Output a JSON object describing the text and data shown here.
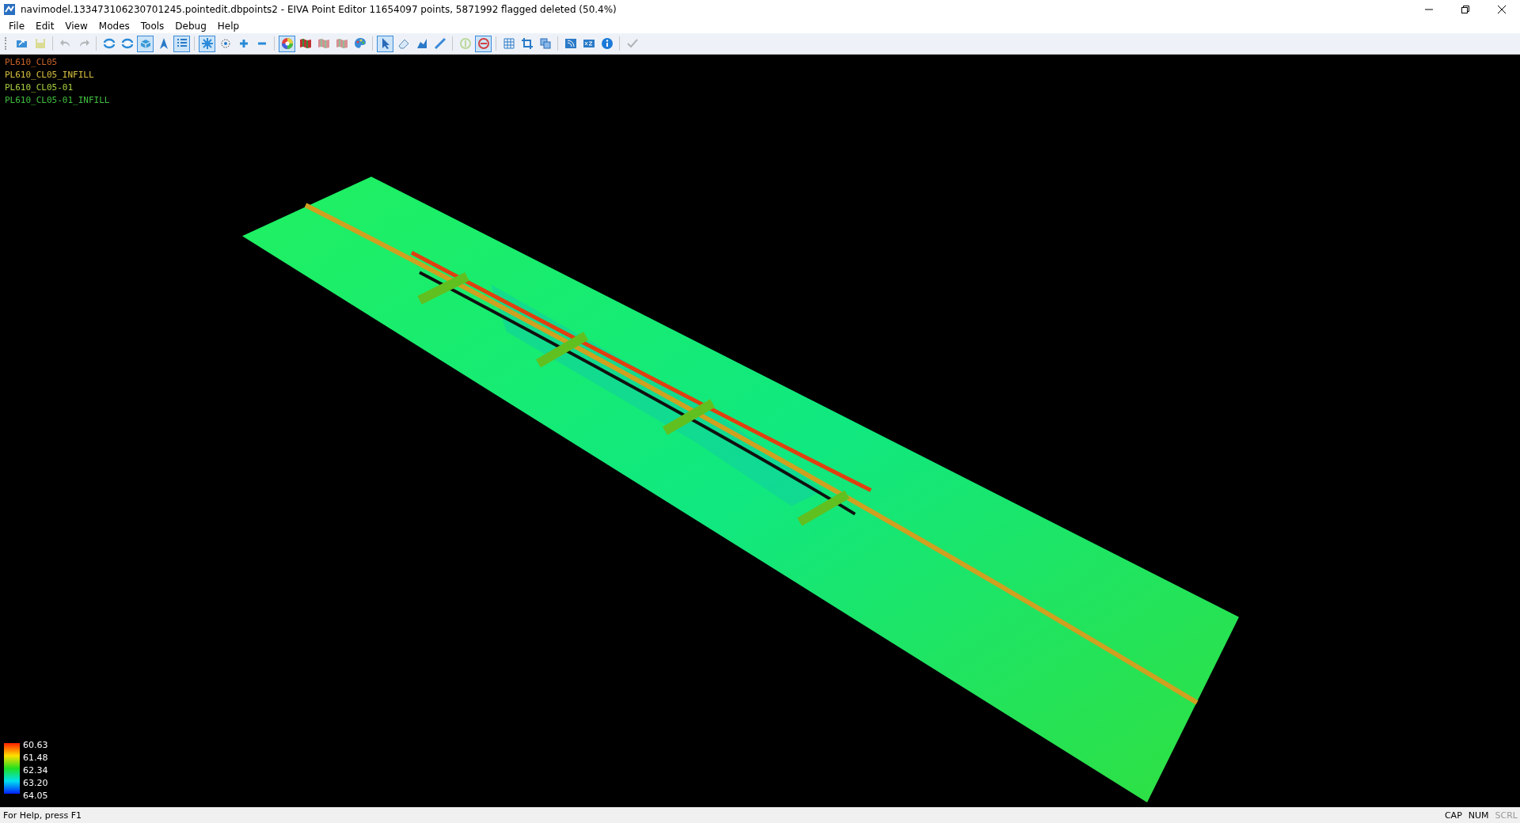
{
  "window": {
    "title": "navimodel.133473106230701245.pointedit.dbpoints2 - EIVA Point Editor 11654097 points, 5871992 flagged deleted (50.4%)"
  },
  "menu": [
    "File",
    "Edit",
    "View",
    "Modes",
    "Tools",
    "Debug",
    "Help"
  ],
  "toolbar": [
    {
      "kind": "open",
      "on": false,
      "disabled": false
    },
    {
      "kind": "save",
      "on": false,
      "disabled": true
    },
    {
      "kind": "separator"
    },
    {
      "kind": "undo",
      "on": false,
      "disabled": true
    },
    {
      "kind": "redo",
      "on": false,
      "disabled": true
    },
    {
      "kind": "separator"
    },
    {
      "kind": "rotate",
      "on": false,
      "disabled": false
    },
    {
      "kind": "rotate",
      "on": false,
      "disabled": false
    },
    {
      "kind": "cube",
      "on": true,
      "disabled": false
    },
    {
      "kind": "north",
      "on": false,
      "disabled": false
    },
    {
      "kind": "list",
      "on": true,
      "disabled": false
    },
    {
      "kind": "separator"
    },
    {
      "kind": "star",
      "on": true,
      "disabled": false
    },
    {
      "kind": "target",
      "on": false,
      "disabled": false
    },
    {
      "kind": "plus",
      "on": false,
      "disabled": false
    },
    {
      "kind": "minus",
      "on": false,
      "disabled": false
    },
    {
      "kind": "separator"
    },
    {
      "kind": "wheel",
      "on": true,
      "disabled": false
    },
    {
      "kind": "map",
      "on": false,
      "disabled": false
    },
    {
      "kind": "map",
      "on": false,
      "disabled": true
    },
    {
      "kind": "map",
      "on": false,
      "disabled": true
    },
    {
      "kind": "palette",
      "on": false,
      "disabled": false
    },
    {
      "kind": "separator"
    },
    {
      "kind": "pointer",
      "on": true,
      "disabled": false
    },
    {
      "kind": "eraser",
      "on": false,
      "disabled": false
    },
    {
      "kind": "shape",
      "on": false,
      "disabled": false
    },
    {
      "kind": "ruler",
      "on": false,
      "disabled": false
    },
    {
      "kind": "separator"
    },
    {
      "kind": "ring",
      "on": false,
      "disabled": true
    },
    {
      "kind": "stop",
      "on": true,
      "disabled": false
    },
    {
      "kind": "separator"
    },
    {
      "kind": "grid",
      "on": false,
      "disabled": false
    },
    {
      "kind": "crop",
      "on": false,
      "disabled": false
    },
    {
      "kind": "layers",
      "on": false,
      "disabled": false
    },
    {
      "kind": "separator"
    },
    {
      "kind": "feed",
      "on": false,
      "disabled": false
    },
    {
      "kind": "xyz",
      "on": false,
      "disabled": false
    },
    {
      "kind": "info",
      "on": false,
      "disabled": false
    },
    {
      "kind": "separator"
    },
    {
      "kind": "check",
      "disabled": true
    }
  ],
  "layers": [
    {
      "name": "PL610_CL05",
      "color": "#c8642a"
    },
    {
      "name": "PL610_CL05_INFILL",
      "color": "#d8c040"
    },
    {
      "name": "PL610_CL05-01",
      "color": "#a8d040"
    },
    {
      "name": "PL610_CL05-01_INFILL",
      "color": "#40c040"
    }
  ],
  "legend": [
    "60.63",
    "61.48",
    "62.34",
    "63.20",
    "64.05"
  ],
  "status_bar": {
    "text": "For Help, press F1",
    "indicators": [
      {
        "label": "CAP",
        "on": true
      },
      {
        "label": "NUM",
        "on": true
      },
      {
        "label": "SCRL",
        "on": false
      }
    ]
  }
}
